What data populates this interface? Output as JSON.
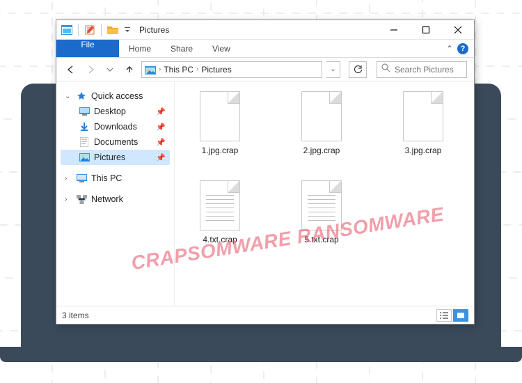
{
  "title": "Pictures",
  "ribbon": {
    "file": "File",
    "home": "Home",
    "share": "Share",
    "view": "View"
  },
  "breadcrumb": {
    "segments": [
      "This PC",
      "Pictures"
    ]
  },
  "search": {
    "placeholder": "Search Pictures"
  },
  "nav": {
    "quick_access": "Quick access",
    "items": [
      {
        "label": "Desktop"
      },
      {
        "label": "Downloads"
      },
      {
        "label": "Documents"
      },
      {
        "label": "Pictures"
      }
    ],
    "this_pc": "This PC",
    "network": "Network"
  },
  "files": [
    {
      "name": "1.jpg.crap",
      "kind": "blank"
    },
    {
      "name": "2.jpg.crap",
      "kind": "blank"
    },
    {
      "name": "3.jpg.crap",
      "kind": "blank"
    },
    {
      "name": "4.txt.crap",
      "kind": "txt"
    },
    {
      "name": "5.txt.crap",
      "kind": "txt"
    }
  ],
  "status": {
    "text": "3 items"
  },
  "watermark": "CRAPSOMWARE RANSOMWARE"
}
